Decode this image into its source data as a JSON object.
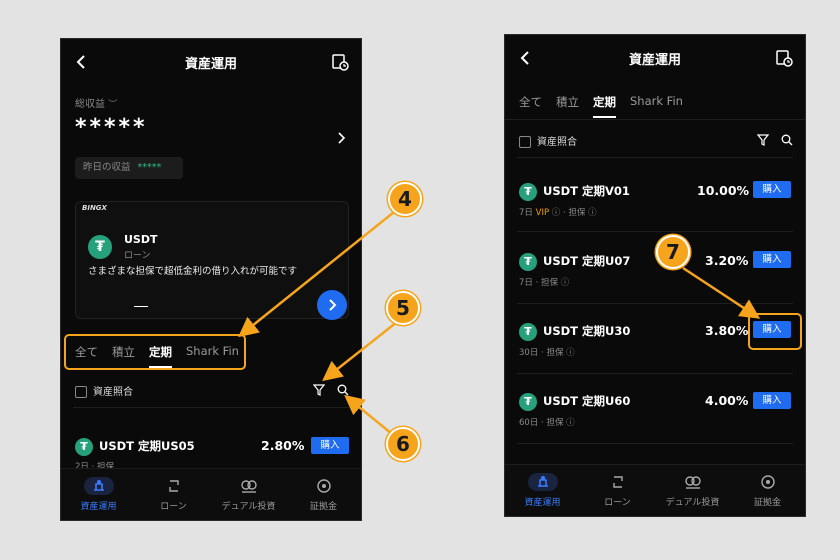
{
  "left": {
    "title": "資産運用",
    "total_label": "総収益",
    "total_value": "*****",
    "yesterday_label": "昨日の収益",
    "yesterday_value": "*****",
    "banner": {
      "brand": "BINGX",
      "coin": "USDT",
      "type": "ローン",
      "desc": "さまざまな担保で超低金利の借り入れが可能です"
    },
    "tabs": [
      "全て",
      "積立",
      "定期",
      "Shark Fin"
    ],
    "active_tab": 2,
    "asset_match_label": "資産照合",
    "product": {
      "name": "USDT 定期US05",
      "rate": "2.80%",
      "buy": "購入",
      "sub": "2日 · 担保"
    }
  },
  "right": {
    "title": "資産運用",
    "tabs": [
      "全て",
      "積立",
      "定期",
      "Shark Fin"
    ],
    "active_tab": 2,
    "asset_match_label": "資産照合",
    "products": [
      {
        "name": "USDT 定期V01",
        "rate": "10.00%",
        "buy": "購入",
        "days": "7日",
        "vip": "VIP",
        "collateral": "担保"
      },
      {
        "name": "USDT 定期U07",
        "rate": "3.20%",
        "buy": "購入",
        "days": "7日",
        "collateral": "担保"
      },
      {
        "name": "USDT 定期U30",
        "rate": "3.80%",
        "buy": "購入",
        "days": "30日",
        "collateral": "担保"
      },
      {
        "name": "USDT 定期U60",
        "rate": "4.00%",
        "buy": "購入",
        "days": "60日",
        "collateral": "担保"
      }
    ]
  },
  "nav": [
    "資産運用",
    "ローン",
    "デュアル投資",
    "証拠金"
  ],
  "callouts": [
    "4",
    "5",
    "6",
    "7"
  ],
  "colors": {
    "accent": "#1f6cf0",
    "callout": "#f6a41c",
    "usdt": "#26a17b",
    "vip": "#f0a000",
    "gain": "#2ebd85"
  }
}
